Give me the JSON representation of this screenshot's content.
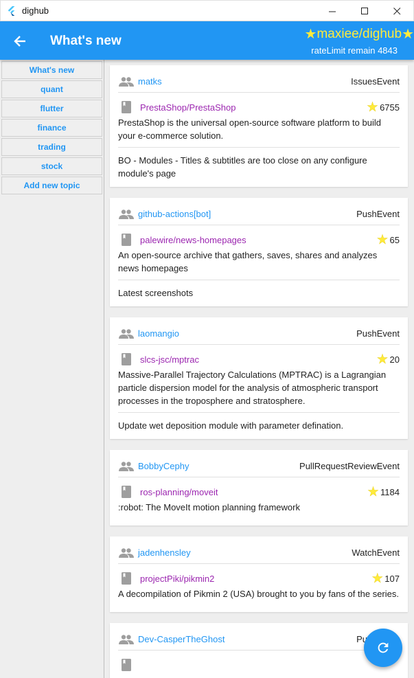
{
  "window": {
    "title": "dighub",
    "controls": [
      "minimize",
      "maximize",
      "close"
    ]
  },
  "appbar": {
    "title": "What's new",
    "repo": "maxiee/dighub",
    "rate_limit": "rateLimit remain 4843",
    "color": "#2196f3",
    "star_color": "#ffeb3b"
  },
  "sidebar": {
    "topics": [
      {
        "label": "What's new"
      },
      {
        "label": "quant"
      },
      {
        "label": "flutter"
      },
      {
        "label": "finance"
      },
      {
        "label": "trading"
      },
      {
        "label": "stock"
      },
      {
        "label": "Add new topic"
      }
    ]
  },
  "events": [
    {
      "actor": "matks",
      "type": "IssuesEvent",
      "repo": "PrestaShop/PrestaShop",
      "stars": "6755",
      "description": "PrestaShop is the universal open-source software platform to build your e-commerce solution.",
      "message": "BO - Modules - Titles & subtitles are too close on any configure module's page"
    },
    {
      "actor": "github-actions[bot]",
      "type": "PushEvent",
      "repo": "palewire/news-homepages",
      "stars": "65",
      "description": "An open-source archive that gathers, saves, shares and analyzes news homepages",
      "message": "Latest screenshots"
    },
    {
      "actor": "laomangio",
      "type": "PushEvent",
      "repo": "slcs-jsc/mptrac",
      "stars": "20",
      "description": "Massive-Parallel Trajectory Calculations (MPTRAC) is a Lagrangian particle dispersion model for the analysis of atmospheric transport processes in the troposphere and stratosphere.",
      "message": "Update wet deposition module with parameter defination."
    },
    {
      "actor": "BobbyCephy",
      "type": "PullRequestReviewEvent",
      "repo": "ros-planning/moveit",
      "stars": "1184",
      "description": ":robot: The MoveIt motion planning framework",
      "message": ""
    },
    {
      "actor": "jadenhensley",
      "type": "WatchEvent",
      "repo": "projectPiki/pikmin2",
      "stars": "107",
      "description": "A decompilation of Pikmin 2 (USA) brought to you by fans of the series.",
      "message": ""
    },
    {
      "actor": "Dev-CasperTheGhost",
      "type": "PushEvent",
      "repo": "",
      "stars": "",
      "description": "",
      "message": ""
    }
  ],
  "fab": {
    "icon": "refresh-icon"
  }
}
